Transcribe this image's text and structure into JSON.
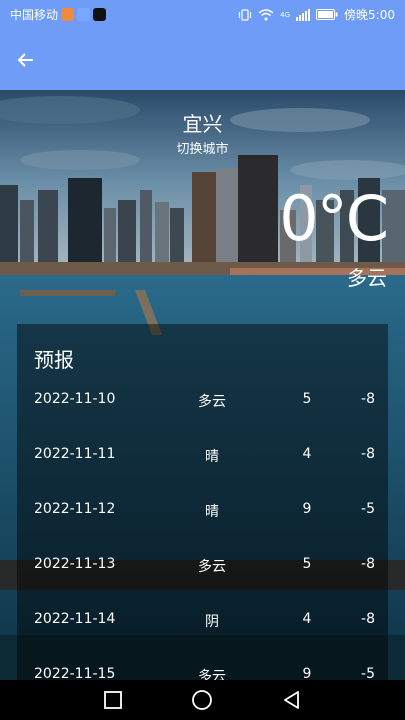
{
  "status_bar": {
    "carrier": "中国移动",
    "network": "4G",
    "time": "傍晚5:00"
  },
  "app_bar": {
    "back_icon": "arrow-left-icon"
  },
  "weather": {
    "city": "宜兴",
    "switch_city": "切换城市",
    "temperature": "0°C",
    "description": "多云"
  },
  "forecast": {
    "title": "预报",
    "rows": [
      {
        "date": "2022-11-10",
        "weather": "多云",
        "max": "5",
        "min": "-8"
      },
      {
        "date": "2022-11-11",
        "weather": "晴",
        "max": "4",
        "min": "-8"
      },
      {
        "date": "2022-11-12",
        "weather": "晴",
        "max": "9",
        "min": "-5"
      },
      {
        "date": "2022-11-13",
        "weather": "多云",
        "max": "5",
        "min": "-8"
      },
      {
        "date": "2022-11-14",
        "weather": "阴",
        "max": "4",
        "min": "-8"
      },
      {
        "date": "2022-11-15",
        "weather": "多云",
        "max": "9",
        "min": "-5"
      }
    ]
  },
  "nav_bar": {
    "icons": [
      "recents-square-icon",
      "home-circle-icon",
      "back-triangle-icon"
    ]
  },
  "colors": {
    "app_bar": "#6e9cf7",
    "overlay": "rgba(0,0,0,0.45)"
  }
}
